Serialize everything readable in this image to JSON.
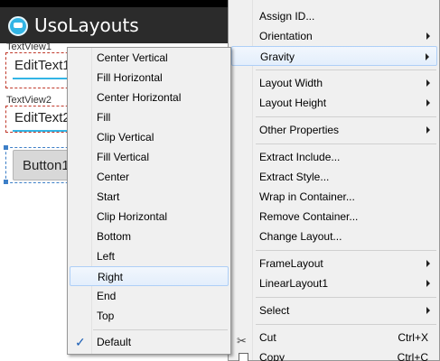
{
  "app": {
    "title": "UsoLayouts"
  },
  "preview": {
    "textview1": "TextView1",
    "edittext1": "EditText1",
    "textview2": "TextView2",
    "edittext2": "EditText2",
    "button1": "Button1"
  },
  "main_menu": {
    "assign_id": "Assign ID...",
    "orientation": "Orientation",
    "gravity": "Gravity",
    "layout_width": "Layout Width",
    "layout_height": "Layout Height",
    "other_properties": "Other Properties",
    "extract_include": "Extract Include...",
    "extract_style": "Extract Style...",
    "wrap_in_container": "Wrap in Container...",
    "remove_container": "Remove Container...",
    "change_layout": "Change Layout...",
    "frame_layout": "FrameLayout",
    "linear_layout1": "LinearLayout1",
    "select": "Select",
    "cut": "Cut",
    "cut_shortcut": "Ctrl+X",
    "copy": "Copy",
    "copy_shortcut": "Ctrl+C"
  },
  "gravity_menu": {
    "items": [
      "Center Vertical",
      "Fill Horizontal",
      "Center Horizontal",
      "Fill",
      "Clip Vertical",
      "Fill Vertical",
      "Center",
      "Start",
      "Clip Horizontal",
      "Bottom",
      "Left",
      "Right",
      "End",
      "Top"
    ],
    "default": "Default",
    "highlighted": "Right",
    "checked": "Default"
  },
  "colors": {
    "action_bar": "#2b2b2b",
    "accent": "#33b5e5",
    "menu_bg": "#f0f0f0",
    "hover_border": "#aecff7"
  },
  "icons": {
    "app": "android-app-icon",
    "submenu": "submenu-arrow-icon",
    "check": "checkmark-icon",
    "cut": "scissors-icon",
    "copy": "copy-icon"
  }
}
